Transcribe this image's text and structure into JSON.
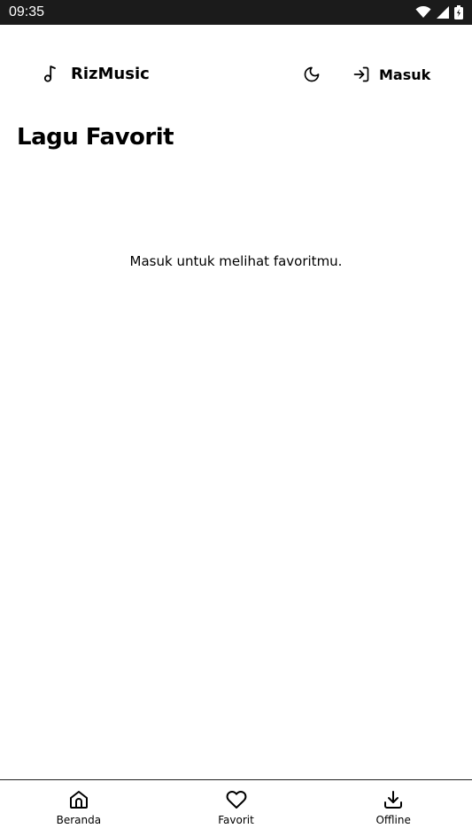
{
  "status_bar": {
    "time": "09:35",
    "icons": [
      "wifi-icon",
      "signal-icon",
      "battery-icon"
    ]
  },
  "header": {
    "brand_icon": "music-note-icon",
    "brand_name": "RizMusic",
    "theme_toggle_icon": "moon-icon",
    "login_icon": "login-arrow-icon",
    "login_label": "Masuk"
  },
  "main": {
    "title": "Lagu Favorit",
    "empty_message": "Masuk untuk melihat favoritmu."
  },
  "bottom_nav": {
    "items": [
      {
        "label": "Beranda",
        "icon": "home-icon"
      },
      {
        "label": "Favorit",
        "icon": "heart-icon"
      },
      {
        "label": "Offline",
        "icon": "download-icon"
      }
    ]
  },
  "colors": {
    "status_bar_bg": "#1b1b1b",
    "background": "#ffffff",
    "text": "#000000"
  }
}
